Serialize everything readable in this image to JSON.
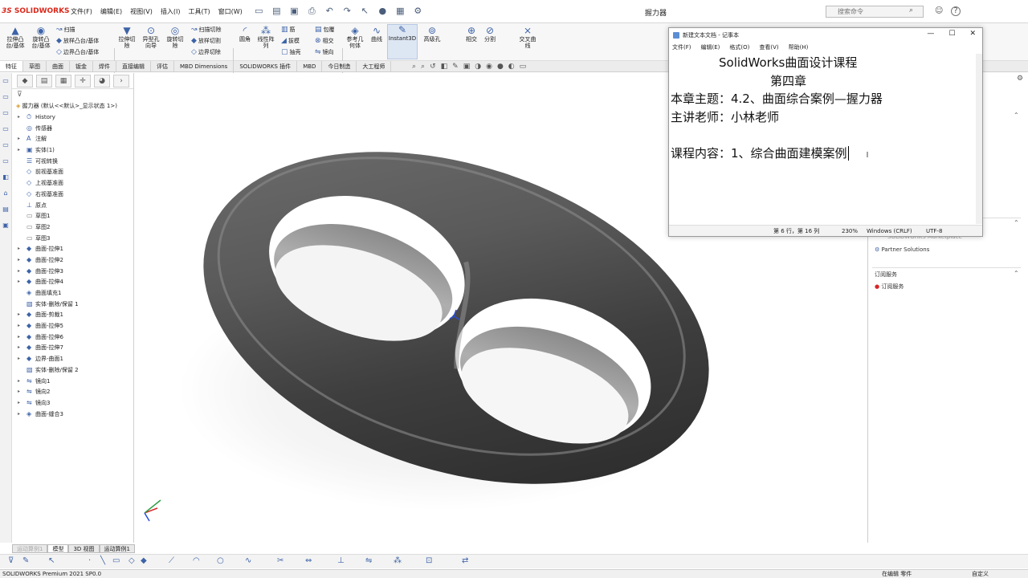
{
  "app": {
    "logo": "SOLIDWORKS",
    "doc_title": "握力器",
    "version": "SOLIDWORKS Premium 2021 SP0.0"
  },
  "menu": [
    "文件(F)",
    "编辑(E)",
    "视图(V)",
    "插入(I)",
    "工具(T)",
    "窗口(W)"
  ],
  "search": {
    "placeholder": "搜索命令"
  },
  "toolbar": {
    "extrude": "拉伸凸\n台/基体",
    "revolve": "旋转凸\n台/基体",
    "sweep": "扫描",
    "loft": "放样凸台/基体",
    "boundary": "边界凸台/基体",
    "extrude_cut": "拉伸切\n除",
    "hole_wizard": "异型孔\n向导",
    "revolve_cut": "旋转切\n除",
    "sweep_cut": "扫描切除",
    "loft_cut": "放样切割",
    "boundary_cut": "边界切除",
    "fillet": "圆角",
    "linear_pattern": "线性阵\n列",
    "rib": "筋",
    "draft": "拔模",
    "shell": "抽壳",
    "wrap": "包覆",
    "intersect": "相交",
    "mirror": "镜向",
    "ref_geometry": "参考几\n何体",
    "curves": "曲线",
    "instant3d": "Instant3D",
    "advanced_hole": "高级孔",
    "combine": "相交",
    "split": "分割",
    "cross_curve": "交叉曲\n线"
  },
  "tabs": [
    "特征",
    "草图",
    "曲面",
    "钣金",
    "焊件",
    "直接编辑",
    "评估",
    "MBD Dimensions",
    "SOLIDWORKS 插件",
    "MBD",
    "今日制造",
    "大工程师"
  ],
  "tree": {
    "root": "握力器  (默认<<默认>_显示状态 1>)",
    "items": [
      {
        "label": "History",
        "icon": "history-icon",
        "expand": "▸"
      },
      {
        "label": "传感器",
        "icon": "sensor-icon",
        "expand": ""
      },
      {
        "label": "注解",
        "icon": "annotation-icon",
        "expand": "▸"
      },
      {
        "label": "实体(1)",
        "icon": "solid-body-icon",
        "expand": "▸"
      },
      {
        "label": "可视转换",
        "icon": "material-icon",
        "expand": ""
      },
      {
        "label": "前视基准面",
        "icon": "plane-icon",
        "expand": ""
      },
      {
        "label": "上视基准面",
        "icon": "plane-icon",
        "expand": ""
      },
      {
        "label": "右视基准面",
        "icon": "plane-icon",
        "expand": ""
      },
      {
        "label": "原点",
        "icon": "origin-icon",
        "expand": ""
      },
      {
        "label": "草图1",
        "icon": "sketch-icon",
        "expand": ""
      },
      {
        "label": "草图2",
        "icon": "sketch-icon",
        "expand": ""
      },
      {
        "label": "草图3",
        "icon": "sketch-icon",
        "expand": ""
      },
      {
        "label": "曲面-拉伸1",
        "icon": "surface-extrude-icon",
        "expand": "▸"
      },
      {
        "label": "曲面-拉伸2",
        "icon": "surface-extrude-icon",
        "expand": "▸"
      },
      {
        "label": "曲面-拉伸3",
        "icon": "surface-extrude-icon",
        "expand": "▸"
      },
      {
        "label": "曲面-拉伸4",
        "icon": "surface-extrude-icon",
        "expand": "▸"
      },
      {
        "label": "曲面填充1",
        "icon": "surface-fill-icon",
        "expand": ""
      },
      {
        "label": "实体-删除/保留 1",
        "icon": "delete-body-icon",
        "expand": ""
      },
      {
        "label": "曲面-剪裁1",
        "icon": "surface-trim-icon",
        "expand": "▸"
      },
      {
        "label": "曲面-拉伸5",
        "icon": "surface-extrude-icon",
        "expand": "▸"
      },
      {
        "label": "曲面-拉伸6",
        "icon": "surface-extrude-icon",
        "expand": "▸"
      },
      {
        "label": "曲面-拉伸7",
        "icon": "surface-extrude-icon",
        "expand": "▸"
      },
      {
        "label": "边界-曲面1",
        "icon": "boundary-surface-icon",
        "expand": "▸"
      },
      {
        "label": "实体-删除/保留 2",
        "icon": "delete-body-icon",
        "expand": ""
      },
      {
        "label": "镜向1",
        "icon": "mirror-icon",
        "expand": "▸"
      },
      {
        "label": "镜向2",
        "icon": "mirror-icon",
        "expand": "▸"
      },
      {
        "label": "镜向3",
        "icon": "mirror-icon",
        "expand": "▸"
      },
      {
        "label": "曲面-缝合3",
        "icon": "knit-surface-icon",
        "expand": "▸"
      }
    ]
  },
  "bottom_tabs": [
    "运动算例1",
    "模型",
    "3D 视图",
    "运动算例1"
  ],
  "status": {
    "left": "SOLIDWORKS Premium 2021 SP0.0",
    "edit": "在编辑 零件",
    "custom": "自定义"
  },
  "right_panel": {
    "marketplace": "SOLIDWORKS Marketplace",
    "partner": "Partner Solutions",
    "subscription_header": "订阅服务",
    "subscription_item": "订阅服务"
  },
  "notepad": {
    "title": "新建文本文档 - 记事本",
    "menu": [
      "文件(F)",
      "编辑(E)",
      "格式(O)",
      "查看(V)",
      "帮助(H)"
    ],
    "lines": [
      "SolidWorks曲面设计课程",
      "第四章",
      "本章主题：4.2、曲面综合案例—握力器",
      "主讲老师：小林老师",
      "",
      "课程内容：1、综合曲面建模案例"
    ],
    "status": {
      "position": "第 6 行，第 16 列",
      "zoom": "230%",
      "eol": "Windows (CRLF)",
      "encoding": "UTF-8"
    }
  }
}
